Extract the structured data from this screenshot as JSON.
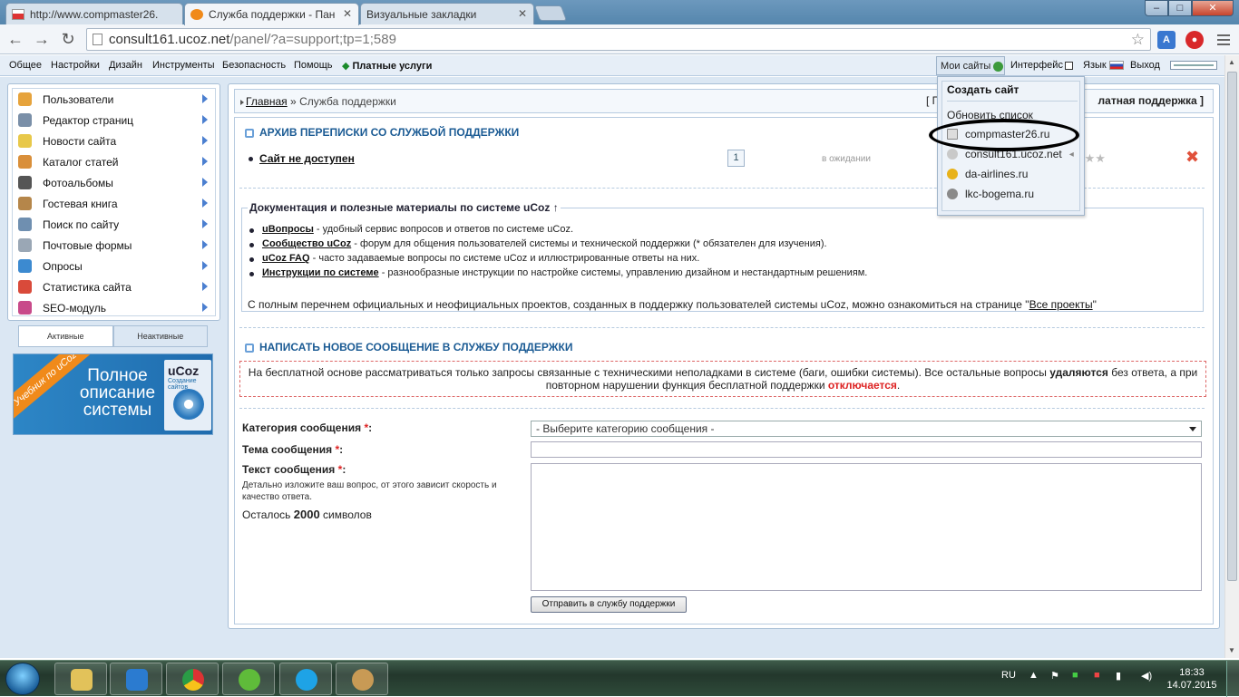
{
  "browser": {
    "tabs": [
      {
        "title": "http://www.compmaster26.",
        "active": false
      },
      {
        "title": "Служба поддержки - Пан",
        "active": true
      },
      {
        "title": "Визуальные закладки",
        "active": false
      }
    ],
    "url_host": "consult161.ucoz.net",
    "url_path": "/panel/?a=support;tp=1;589",
    "window_buttons": {
      "minimize": "–",
      "maximize": "□",
      "close": "✕"
    }
  },
  "topmenu": {
    "items": [
      "Общее",
      "Настройки",
      "Дизайн",
      "Инструменты",
      "Безопасность",
      "Помощь"
    ],
    "paid": "Платные услуги",
    "mysites": "Мои сайты",
    "interface": "Интерфейс",
    "language": "Язык",
    "logout": "Выход"
  },
  "sidebar": {
    "items": [
      {
        "label": "Пользователи",
        "icon": "users-icon",
        "color": "#e6a33c"
      },
      {
        "label": "Редактор страниц",
        "icon": "page-editor-icon",
        "color": "#7a8fa8"
      },
      {
        "label": "Новости сайта",
        "icon": "news-icon",
        "color": "#e8c84a"
      },
      {
        "label": "Каталог статей",
        "icon": "articles-icon",
        "color": "#d98f3a"
      },
      {
        "label": "Фотоальбомы",
        "icon": "photo-icon",
        "color": "#555555"
      },
      {
        "label": "Гостевая книга",
        "icon": "guestbook-icon",
        "color": "#b5864a"
      },
      {
        "label": "Поиск по сайту",
        "icon": "search-icon",
        "color": "#6f8fb0"
      },
      {
        "label": "Почтовые формы",
        "icon": "mail-icon",
        "color": "#9aa7b5"
      },
      {
        "label": "Опросы",
        "icon": "polls-icon",
        "color": "#3c8ad0"
      },
      {
        "label": "Статистика сайта",
        "icon": "stats-icon",
        "color": "#d94a3a"
      },
      {
        "label": "SEO-модуль",
        "icon": "seo-icon",
        "color": "#c84a8a"
      }
    ],
    "tab_active": "Активные",
    "tab_inactive": "Неактивные",
    "banner": {
      "ribbon": "Учебник по uCoz",
      "text": "Полное описание системы",
      "logo": "uCoz",
      "logo_sub": "Создание сайтов"
    }
  },
  "breadcrumb": {
    "home": "Главная",
    "sep": "»",
    "current": "Служба поддержки",
    "bracket_left": "[ П",
    "paid_support": "латная поддержка ]"
  },
  "archive": {
    "title": "Архив переписки со службой поддержки",
    "ticket": {
      "name": "Сайт не доступен",
      "count": "1",
      "status": "в ожидании",
      "stars": "★★★"
    }
  },
  "docs": {
    "legend": "Документация и полезные материалы по системе uCoz ↑",
    "items": [
      {
        "link": "uВопросы",
        "text": " - удобный сервис вопросов и ответов по системе uCoz."
      },
      {
        "link": "Сообщество uCoz",
        "text": " - форум для общения пользователей системы и технической поддержки (* обязателен для изучения)."
      },
      {
        "link": "uCoz FAQ",
        "text": " - часто задаваемые вопросы по системе uCoz и иллюстрированные ответы на них."
      },
      {
        "link": "Инструкции по системе",
        "text": " - разнообразные инструкции по настройке системы, управлению дизайном и нестандартным решениям."
      }
    ],
    "footer": "С полным перечнем официальных и неофициальных проектов, созданных в поддержку пользователей системы uCoz, можно ознакомиться на странице \"",
    "footer_link": "Все проекты",
    "footer_end": "\""
  },
  "newmsg": {
    "title": "Написать новое сообщение в службу поддержки",
    "warning_1": "На бесплатной основе рассматриваться только запросы связанные с техническими неполадками в системе (баги, ошибки системы). Все остальные вопросы ",
    "warning_bold": "удаляются",
    "warning_2": " без ответа, а при повторном нарушении функция бесплатной поддержки ",
    "warning_red": "отключается",
    "warning_end": "."
  },
  "form": {
    "category_label": "Категория сообщения",
    "category_placeholder": "- Выберите категорию сообщения -",
    "subject_label": "Тема сообщения",
    "body_label": "Текст сообщения",
    "required_mark": "*",
    "colon": ":",
    "hint": "Детально изложите ваш вопрос, от этого зависит скорость и качество ответа.",
    "remaining_prefix": "Осталось",
    "remaining_count": "2000",
    "remaining_suffix": "символов",
    "submit": "Отправить в службу поддержки"
  },
  "dropdown": {
    "create": "Создать сайт",
    "refresh": "Обновить список",
    "sites": [
      {
        "name": "compmaster26.ru",
        "color": "#dddddd"
      },
      {
        "name": "consult161.ucoz.net",
        "color": "#c9c9c9"
      },
      {
        "name": "da-airlines.ru",
        "color": "#e8b21a"
      },
      {
        "name": "lkc-bogema.ru",
        "color": "#8a8a8a"
      }
    ],
    "current_marker": "◂"
  },
  "taskbar": {
    "lang": "RU",
    "time": "18:33",
    "date": "14.07.2015",
    "apps": [
      "explorer",
      "media",
      "chrome",
      "utorrent",
      "skype",
      "paint"
    ]
  }
}
